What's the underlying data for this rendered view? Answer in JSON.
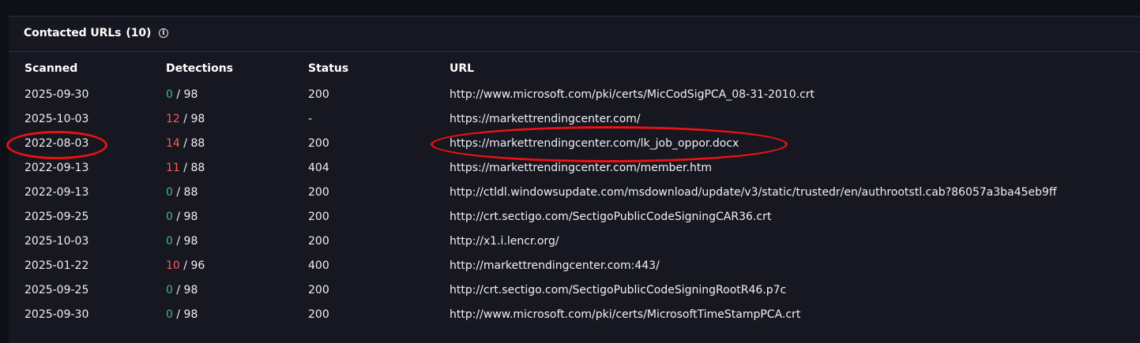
{
  "section": {
    "title": "Contacted URLs",
    "count": "(10)",
    "info_icon": "info-circle-icon"
  },
  "columns": {
    "scanned": "Scanned",
    "detections": "Detections",
    "status": "Status",
    "url": "URL"
  },
  "colors": {
    "background": "#0f1017",
    "card": "#161720",
    "detections_positive": "#ff5a52",
    "detections_zero": "#3fb58a",
    "annotation": "#ee1111"
  },
  "rows": [
    {
      "scanned": "2025-09-30",
      "detections": "0",
      "total": " / 98",
      "status": "200",
      "url": "http://www.microsoft.com/pki/certs/MicCodSigPCA_08-31-2010.crt"
    },
    {
      "scanned": "2025-10-03",
      "detections": "12",
      "total": " / 98",
      "status": "-",
      "url": "https://markettrendingcenter.com/"
    },
    {
      "scanned": "2022-08-03",
      "detections": "14",
      "total": " / 88",
      "status": "200",
      "url": "https://markettrendingcenter.com/lk_job_oppor.docx"
    },
    {
      "scanned": "2022-09-13",
      "detections": "11",
      "total": " / 88",
      "status": "404",
      "url": "https://markettrendingcenter.com/member.htm"
    },
    {
      "scanned": "2022-09-13",
      "detections": "0",
      "total": " / 88",
      "status": "200",
      "url": "http://ctldl.windowsupdate.com/msdownload/update/v3/static/trustedr/en/authrootstl.cab?86057a3ba45eb9ff"
    },
    {
      "scanned": "2025-09-25",
      "detections": "0",
      "total": " / 98",
      "status": "200",
      "url": "http://crt.sectigo.com/SectigoPublicCodeSigningCAR36.crt"
    },
    {
      "scanned": "2025-10-03",
      "detections": "0",
      "total": " / 98",
      "status": "200",
      "url": "http://x1.i.lencr.org/"
    },
    {
      "scanned": "2025-01-22",
      "detections": "10",
      "total": " / 96",
      "status": "400",
      "url": "http://markettrendingcenter.com:443/"
    },
    {
      "scanned": "2025-09-25",
      "detections": "0",
      "total": " / 98",
      "status": "200",
      "url": "http://crt.sectigo.com/SectigoPublicCodeSigningRootR46.p7c"
    },
    {
      "scanned": "2025-09-30",
      "detections": "0",
      "total": " / 98",
      "status": "200",
      "url": "http://www.microsoft.com/pki/certs/MicrosoftTimeStampPCA.crt"
    }
  ]
}
